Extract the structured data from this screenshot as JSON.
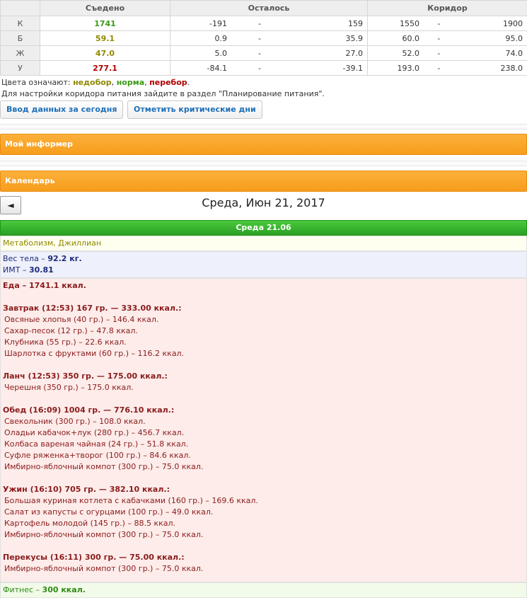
{
  "table": {
    "headers": [
      "",
      "Съедено",
      "Осталось",
      "Коридор"
    ],
    "rows": [
      {
        "label": "К",
        "eaten": "1741",
        "eaten_color": "green",
        "rem_lo": "-191",
        "rem_hi": "159",
        "cor_lo": "1550",
        "cor_hi": "1900"
      },
      {
        "label": "Б",
        "eaten": "59.1",
        "eaten_color": "olive",
        "rem_lo": "0.9",
        "rem_hi": "35.9",
        "cor_lo": "60.0",
        "cor_hi": "95.0"
      },
      {
        "label": "Ж",
        "eaten": "47.0",
        "eaten_color": "olive",
        "rem_lo": "5.0",
        "rem_hi": "27.0",
        "cor_lo": "52.0",
        "cor_hi": "74.0"
      },
      {
        "label": "У",
        "eaten": "277.1",
        "eaten_color": "red",
        "rem_lo": "-84.1",
        "rem_hi": "-39.1",
        "cor_lo": "193.0",
        "cor_hi": "238.0"
      }
    ],
    "range_sep": "-"
  },
  "legend": {
    "prefix": "Цвета означают: ",
    "under": "недобор",
    "norm": "норма",
    "over": "перебор"
  },
  "hint": "Для настройки коридора питания зайдите в раздел \"Планирование питания\".",
  "buttons": {
    "enter_today": "Ввод данных за сегодня",
    "critical_days": "Отметить критические дни"
  },
  "panels": {
    "informer": "Мой информер",
    "calendar": "Календарь"
  },
  "calendar": {
    "prev_icon": "◄",
    "title": "Среда, Июн 21, 2017",
    "day_header": "Среда 21.06",
    "metabolism": "Метаболизм, Джиллиан",
    "weight_label": "Вес тела",
    "weight_value": "92.2 кг.",
    "bmi_label": "ИМТ",
    "bmi_value": "30.81",
    "food_label": "Еда",
    "food_value": "1741.1 ккал.",
    "dash": " – ",
    "meals": [
      {
        "title": "Завтрак (12:53) 167 гр. — 333.00 ккал.:",
        "items": [
          "Овсяные хлопья (40 гр.) – 146.4 ккал.",
          "Сахар-песок (12 гр.) – 47.8 ккал.",
          "Клубника (55 гр.) – 22.6 ккал.",
          "Шарлотка с фруктами (60 гр.) – 116.2 ккал."
        ]
      },
      {
        "title": "Ланч (12:53) 350 гр. — 175.00 ккал.:",
        "items": [
          "Черешня (350 гр.) – 175.0 ккал."
        ]
      },
      {
        "title": "Обед (16:09) 1004 гр. — 776.10 ккал.:",
        "items": [
          "Свекольник (300 гр.) – 108.0 ккал.",
          "Оладьи кабачок+лук (280 гр.) – 456.7 ккал.",
          "Колбаса вареная чайная (24 гр.) – 51.8 ккал.",
          "Суфле ряженка+творог (100 гр.) – 84.6 ккал.",
          "Имбирно-яблочный компот (300 гр.) – 75.0 ккал."
        ]
      },
      {
        "title": "Ужин (16:10) 705 гр. — 382.10 ккал.:",
        "items": [
          "Большая куриная котлета с кабачками (160 гр.) – 169.6 ккал.",
          "Салат из капусты с огурцами (100 гр.) – 49.0 ккал.",
          "Картофель молодой (145 гр.) – 88.5 ккал.",
          "Имбирно-яблочный компот (300 гр.) – 75.0 ккал."
        ]
      },
      {
        "title": "Перекусы (16:11) 300 гр. — 75.00 ккал.:",
        "items": [
          "Имбирно-яблочный компот (300 гр.) – 75.0 ккал."
        ]
      }
    ],
    "fitness_label": "Фитнес",
    "fitness_value": "300 ккал."
  },
  "colors": {
    "under": "#8f8a00",
    "norm": "#3a9a15",
    "over": "#b00000",
    "panel_orange": "#f79d1c",
    "day_green": "#2aa022"
  }
}
